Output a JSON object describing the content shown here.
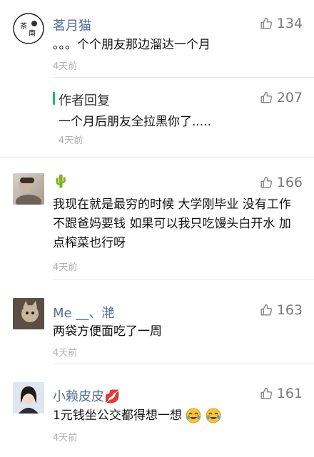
{
  "comments": [
    {
      "user": "茗月猫",
      "likes": "134",
      "text": "。。。个个朋友那边溜达一个月",
      "time": "4天前",
      "reply": {
        "label": "作者回复",
        "likes": "207",
        "text": "一个月后朋友全拉黑你了.....",
        "time": "4天前"
      }
    },
    {
      "user": "🌵",
      "likes": "166",
      "text": "我现在就是最穷的时候  大学刚毕业 没有工作不跟爸妈要钱  如果可以我只吃馒头白开水 加点榨菜也行呀",
      "time": "4天前"
    },
    {
      "user": "Me __、滟",
      "likes": "163",
      "text": "两袋方便面吃了一周",
      "time": "4天前"
    },
    {
      "user": "小赖皮皮💋",
      "likes": "161",
      "text": "1元钱坐公交都得想一想",
      "time": "4天前"
    }
  ]
}
